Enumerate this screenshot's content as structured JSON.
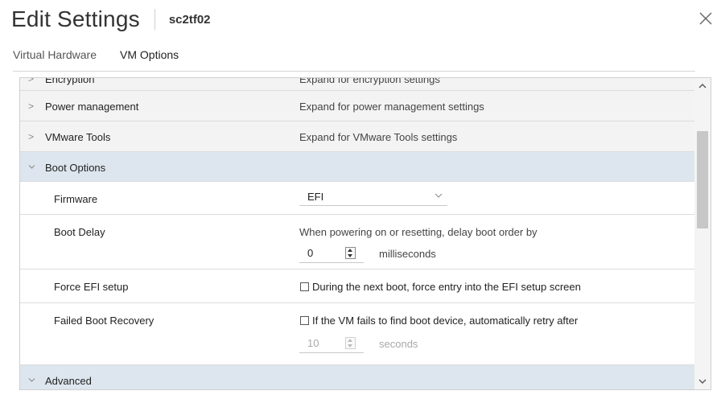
{
  "header": {
    "title": "Edit Settings",
    "vm_name": "sc2tf02"
  },
  "tabs": [
    {
      "label": "Virtual Hardware"
    },
    {
      "label": "VM Options"
    }
  ],
  "rows": {
    "encryption": {
      "label": "Encryption",
      "value": "Expand for encryption settings"
    },
    "power": {
      "label": "Power management",
      "value": "Expand for power management settings"
    },
    "tools": {
      "label": "VMware Tools",
      "value": "Expand for VMware Tools settings"
    },
    "boot": {
      "label": "Boot Options"
    },
    "firmware": {
      "label": "Firmware",
      "selected": "EFI"
    },
    "boot_delay": {
      "label": "Boot Delay",
      "description": "When powering on or resetting, delay boot order by",
      "value": "0",
      "unit": "milliseconds"
    },
    "force_efi": {
      "label": "Force EFI setup",
      "checkbox_label": "During the next boot, force entry into the EFI setup screen"
    },
    "failed_boot": {
      "label": "Failed Boot Recovery",
      "checkbox_label": "If the VM fails to find boot device, automatically retry after",
      "value": "10",
      "unit": "seconds"
    },
    "advanced": {
      "label": "Advanced"
    }
  },
  "icons": {
    "collapsed": "chevron-right-icon",
    "expanded": "chevron-down-icon",
    "close": "close-icon"
  },
  "colors": {
    "expanded_row": "#dde6ee",
    "section_row": "#f3f3f3",
    "scroll_thumb": "#c7c7c7"
  }
}
